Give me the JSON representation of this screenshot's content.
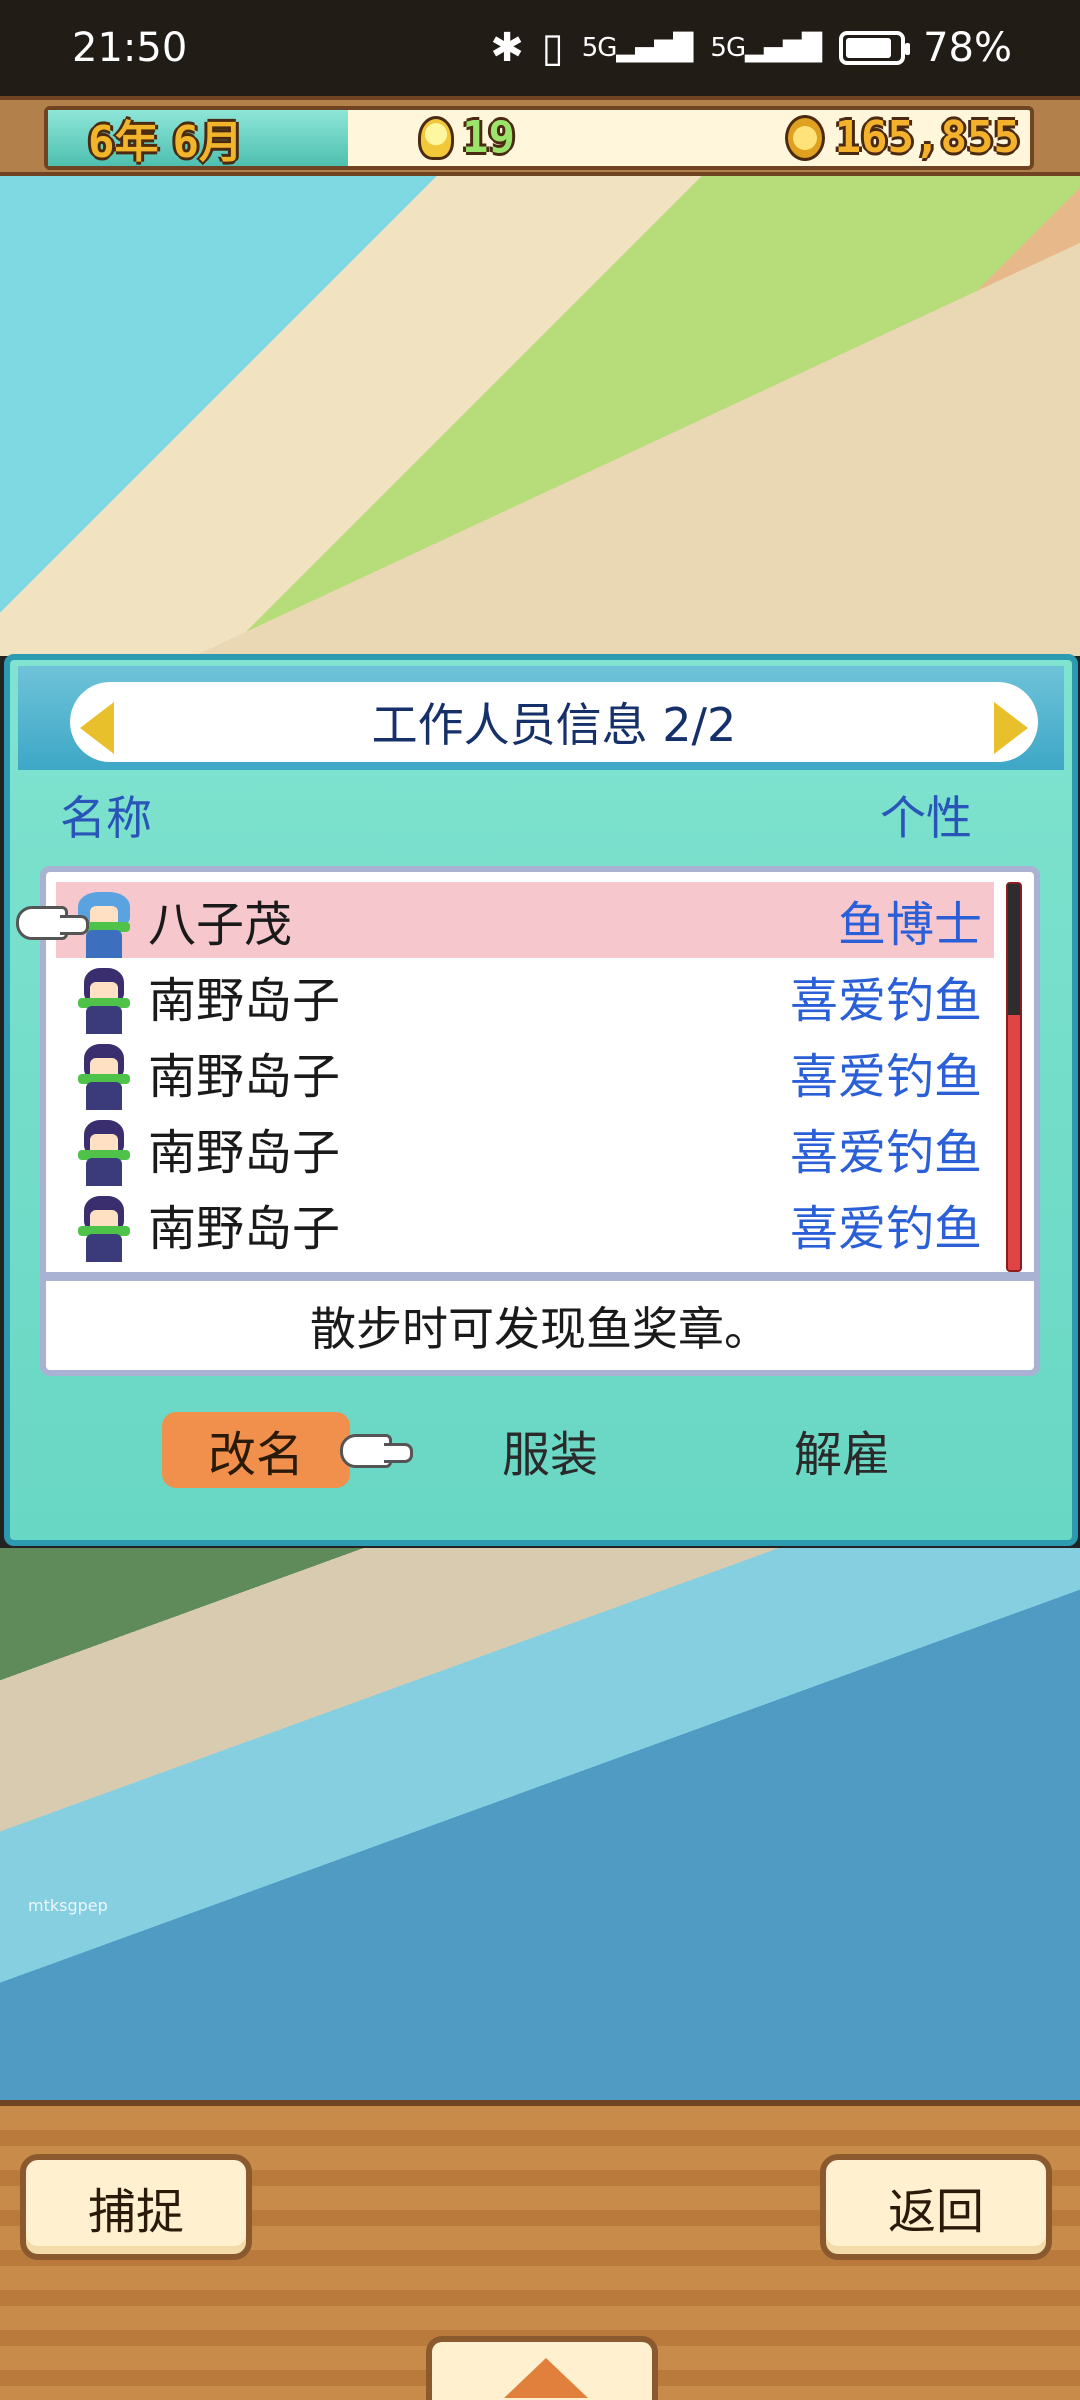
{
  "status_bar": {
    "time": "21:50",
    "bluetooth_icon": "bluetooth-icon",
    "signal1": "5G",
    "signal2": "5G",
    "battery_percent": "78%",
    "battery_level": 0.78
  },
  "hud": {
    "year": "6年",
    "month": "6月",
    "ideas": "19",
    "money": "165,855"
  },
  "dialog": {
    "title": "工作人员信息 2/2",
    "col_name": "名称",
    "col_trait": "个性",
    "rows": [
      {
        "name": "八子茂",
        "trait": "鱼博士"
      },
      {
        "name": "南野岛子",
        "trait": "喜爱钓鱼"
      },
      {
        "name": "南野岛子",
        "trait": "喜爱钓鱼"
      },
      {
        "name": "南野岛子",
        "trait": "喜爱钓鱼"
      },
      {
        "name": "南野岛子",
        "trait": "喜爱钓鱼"
      }
    ],
    "description": "散步时可发现鱼奖章。",
    "actions": {
      "rename": "改名",
      "outfit": "服装",
      "dismiss": "解雇"
    }
  },
  "watermark": "mtksgpep",
  "bottom": {
    "capture": "捕捉",
    "back": "返回"
  }
}
